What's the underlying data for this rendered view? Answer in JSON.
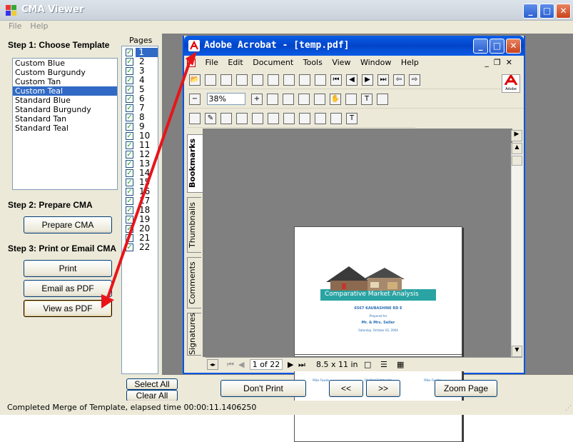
{
  "main_window": {
    "title": "CMA Viewer",
    "menu": [
      "File",
      "Help"
    ]
  },
  "left_panel": {
    "step1": "Step 1: Choose Template",
    "templates": [
      "Custom Blue",
      "Custom Burgundy",
      "Custom Tan",
      "Custom Teal",
      "Standard Blue",
      "Standard Burgundy",
      "Standard Tan",
      "Standard Teal"
    ],
    "selected_template": "Custom Teal",
    "pages_label": "Pages",
    "pages": [
      "1",
      "2",
      "3",
      "4",
      "5",
      "6",
      "7",
      "8",
      "9",
      "10",
      "11",
      "12",
      "13",
      "14",
      "15",
      "16",
      "17",
      "18",
      "19",
      "20",
      "21",
      "22"
    ],
    "step2": "Step 2: Prepare CMA",
    "prepare_button": "Prepare CMA",
    "step3": "Step 3: Print or Email CMA",
    "print_button": "Print",
    "email_button": "Email as PDF",
    "view_button": "View as PDF",
    "select_all_button": "Select All",
    "clear_all_button": "Clear All"
  },
  "bottom_bar": {
    "dont_print_button": "Don't Print",
    "prev_button": "<<",
    "next_button": ">>",
    "zoom_button": "Zoom Page",
    "status": "Completed Merge of Template, elapsed time 00:00:11.1406250"
  },
  "acrobat": {
    "title": "Adobe Acrobat - [temp.pdf]",
    "menu": [
      "File",
      "Edit",
      "Document",
      "Tools",
      "View",
      "Window",
      "Help"
    ],
    "zoom": "38%",
    "side_tabs": [
      "Bookmarks",
      "Thumbnails",
      "Comments",
      "Signatures"
    ],
    "page_indicator": "1 of 22",
    "page_size": "8.5 x 11 in",
    "adobe_logo": "Adobe",
    "pdf": {
      "banner": "Comparative Market Analysis",
      "address": "6567 KAUBASHINE RD E",
      "prepared_for_label": "Prepared for",
      "client": "Mr. & Mrs. Seller",
      "date": "Saturday, October 02, 2004",
      "footer": [
        "Mike Fowler",
        "5th Real Estate Ltd.",
        "Mike Fowler"
      ]
    }
  },
  "colors": {
    "selection": "#316ac5",
    "xp_blue": "#0054e3",
    "arrow": "#e8141a",
    "banner_teal": "#2aa3a3"
  }
}
